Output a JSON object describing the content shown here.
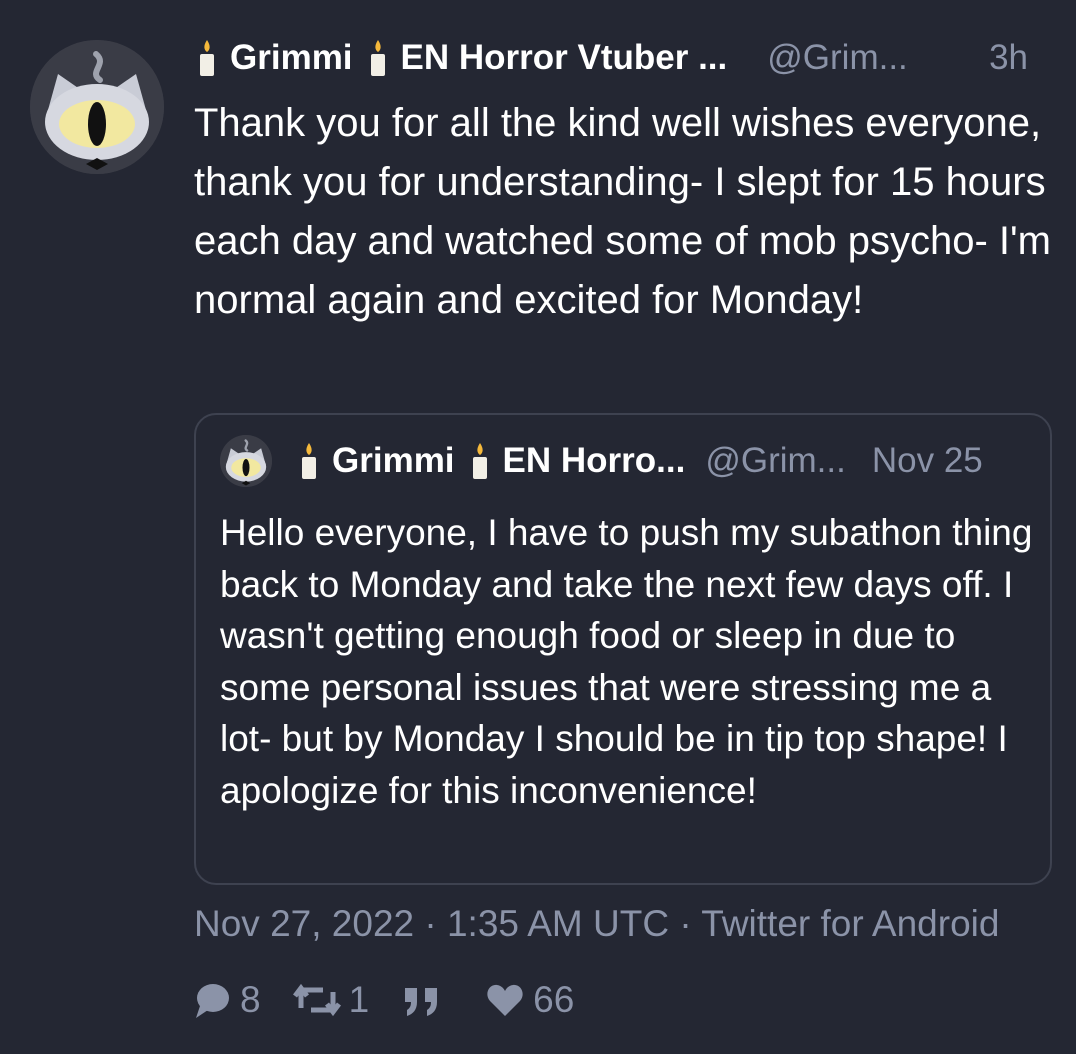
{
  "tweet": {
    "author_name_1": "Grimmi",
    "author_name_2": "EN Horror Vtuber ...",
    "handle": "@Grim...",
    "time": "3h",
    "text": "Thank you for all the kind well wishes everyone, thank you for understanding- I slept for 15 hours each day and watched some of mob psycho- I'm normal again and excited for Monday!",
    "avatar_icon": "cat-eye-avatar-icon",
    "name_emoji_icon": "candle-icon"
  },
  "quote": {
    "author_name_1": "Grimmi",
    "author_name_2": "EN Horro...",
    "handle": "@Grim...",
    "date": "Nov 25",
    "text": "Hello everyone, I have to push my subathon thing back to Monday and take the next few days off. I wasn't getting enough food or sleep in due to some personal issues that were stressing me a lot- but by Monday I should be in tip top shape! I apologize for this inconvenience!"
  },
  "meta": {
    "timestamp": "Nov 27, 2022 · 1:35 AM UTC · Twitter for Android"
  },
  "stats": {
    "replies": "8",
    "retweets": "1",
    "quotes_icon": "quote-icon",
    "likes": "66"
  },
  "colors": {
    "background": "#242733",
    "muted_text": "#8b93a8",
    "border": "#3e4250"
  }
}
